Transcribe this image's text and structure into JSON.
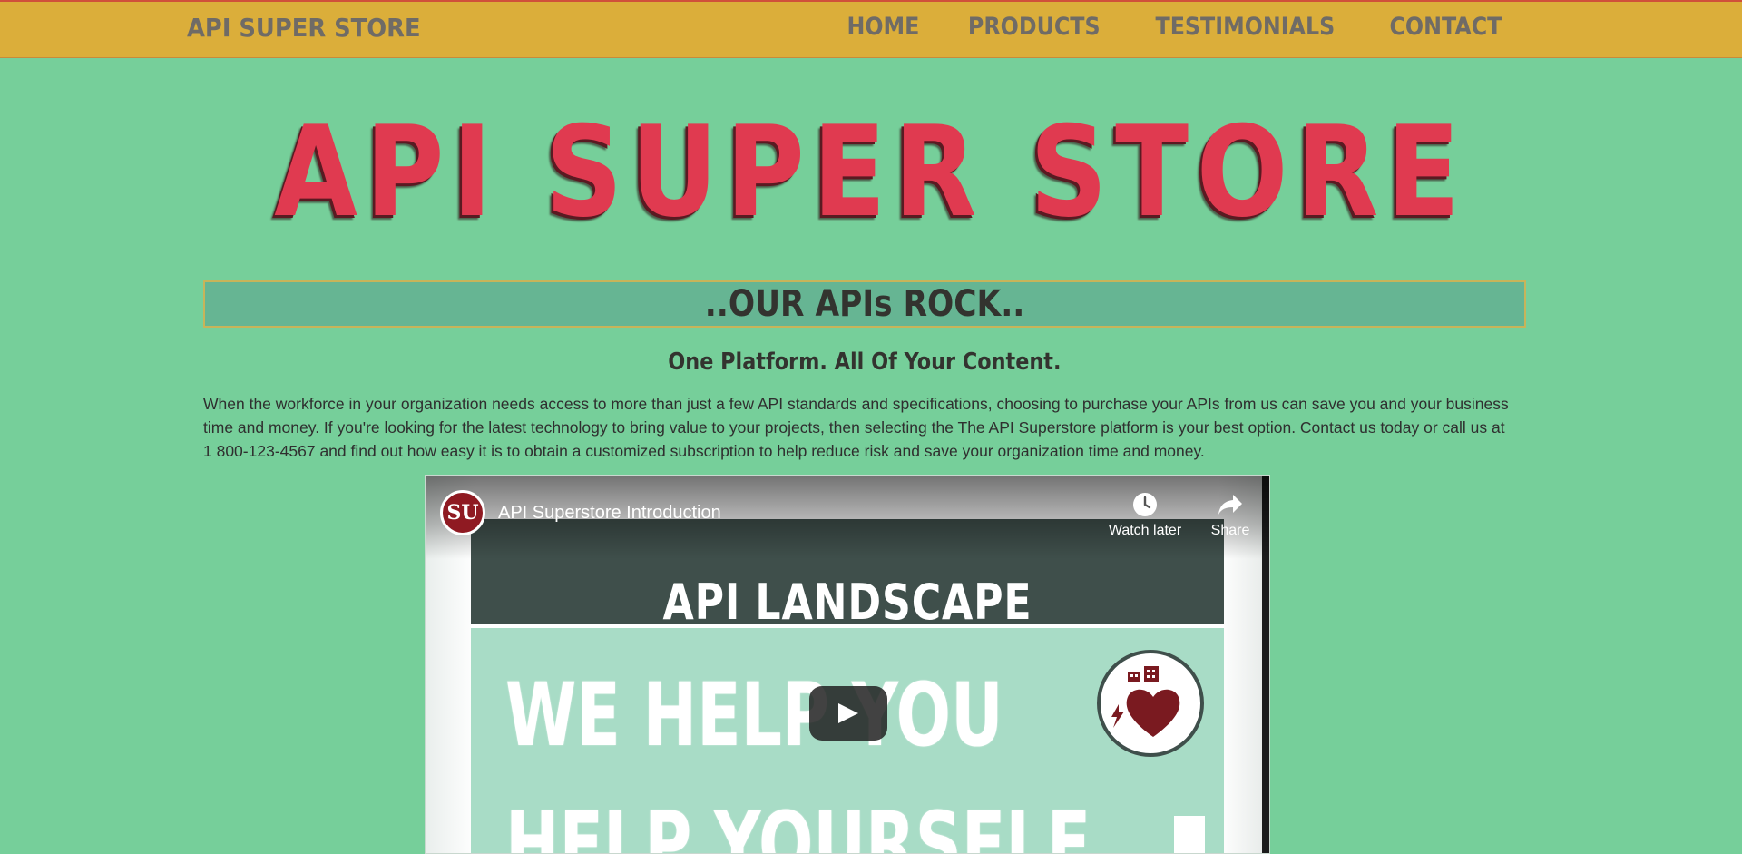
{
  "navbar": {
    "brand": "API SUPER STORE",
    "links": [
      {
        "label": "HOME"
      },
      {
        "label": "PRODUCTS"
      },
      {
        "label": "TESTIMONIALS"
      },
      {
        "label": "CONTACT"
      }
    ]
  },
  "hero": {
    "title": "API SUPER STORE"
  },
  "banner": {
    "text": "..OUR APIs ROCK.."
  },
  "subheading": "One Platform. All Of Your Content.",
  "intro": "When the workforce in your organization needs access to more than just a few API standards and specifications, choosing to purchase your APIs from us can save you and your business time and money. If you're looking for the latest technology to bring value to your projects, then selecting the The API Superstore platform is your best option. Contact us today or call us at 1 800-123-4567 and find out how easy it is to obtain a customized subscription to help reduce risk and save your organization time and money.",
  "video": {
    "title": "API Superstore Introduction",
    "channel_initials": "SU",
    "watch_later": "Watch later",
    "share": "Share",
    "slide_header": "API  LANDSCAPE",
    "slide_line_1": "WE HELP YOU",
    "slide_line_2": "HELP YOURSELF"
  },
  "colors": {
    "page_bg": "#76cf9a",
    "navbar_bg": "#dbae3a",
    "nav_text": "#6f6b66",
    "hero_red": "#e03a50",
    "banner_bg": "#66b593",
    "dark_text": "#33332f"
  },
  "icons": {
    "watch_later": "clock-icon",
    "share": "share-arrow-icon",
    "play": "play-icon",
    "badge": "heart-icon"
  }
}
